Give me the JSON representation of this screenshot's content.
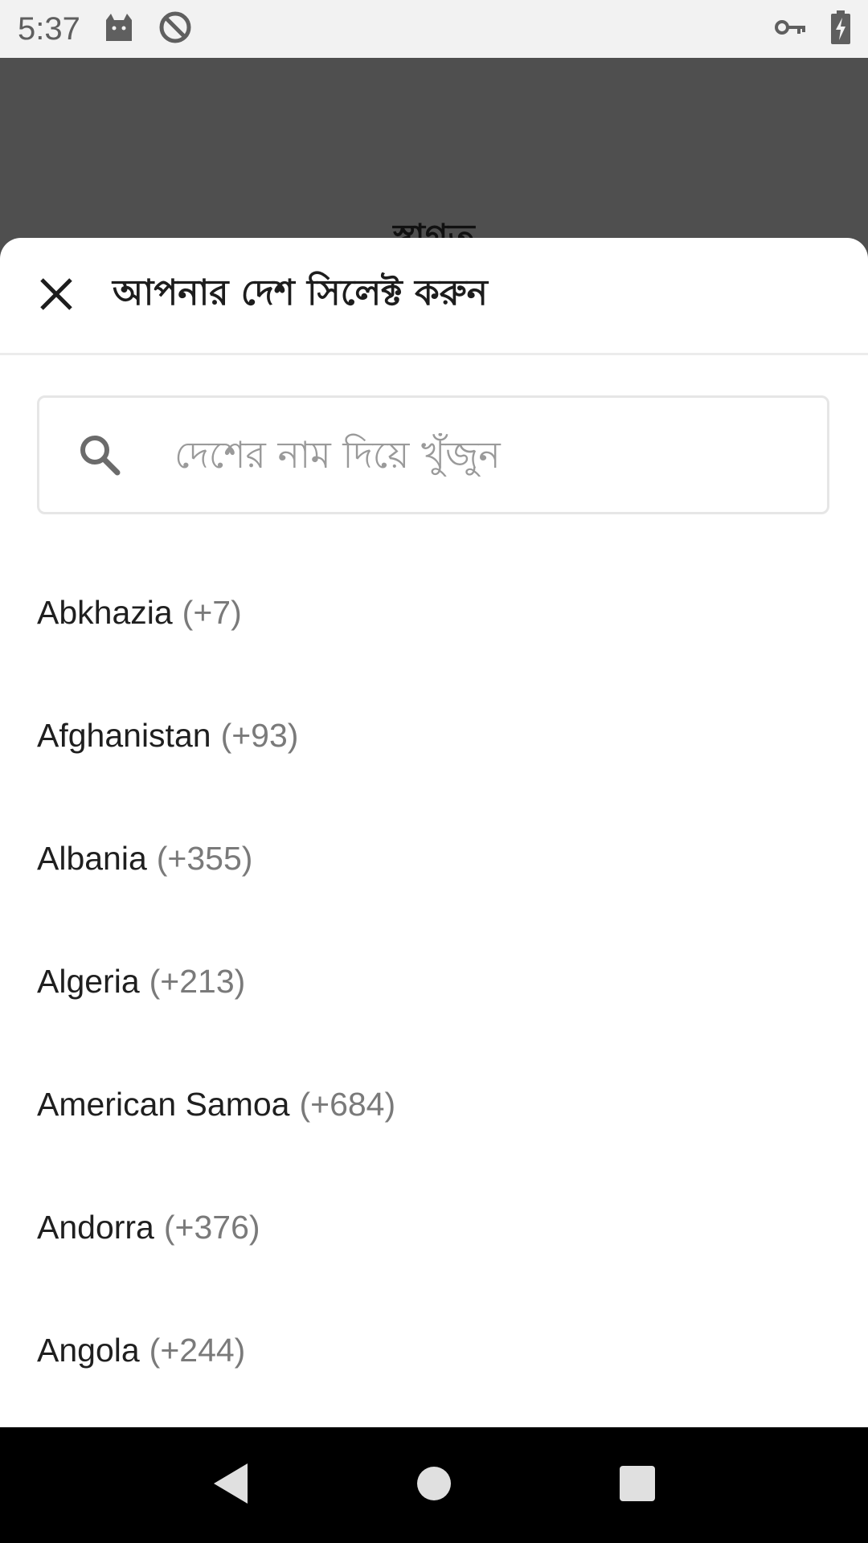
{
  "status_bar": {
    "time": "5:37",
    "icons_left": [
      "cat-icon",
      "do-not-disturb-icon"
    ],
    "icons_right": [
      "vpn-key-icon",
      "battery-charging-icon"
    ]
  },
  "background_app": {
    "title": "স্বাগত"
  },
  "sheet": {
    "title": "আপনার দেশ সিলেক্ট করুন",
    "search": {
      "placeholder": "দেশের নাম দিয়ে খুঁজুন",
      "value": ""
    },
    "countries": [
      {
        "name": "Abkhazia",
        "code": "(+7)"
      },
      {
        "name": "Afghanistan",
        "code": "(+93)"
      },
      {
        "name": "Albania",
        "code": "(+355)"
      },
      {
        "name": "Algeria",
        "code": "(+213)"
      },
      {
        "name": "American Samoa",
        "code": "(+684)"
      },
      {
        "name": "Andorra",
        "code": "(+376)"
      },
      {
        "name": "Angola",
        "code": "(+244)"
      }
    ]
  },
  "nav_bar": {
    "icons": [
      "back-icon",
      "home-icon",
      "recents-icon"
    ]
  },
  "colors": {
    "status_bar_bg": "#f2f2f2",
    "scrim": "#4f4f4f",
    "sheet_bg": "#ffffff",
    "nav_bar_bg": "#000000",
    "code_text": "#7a7a7a"
  }
}
